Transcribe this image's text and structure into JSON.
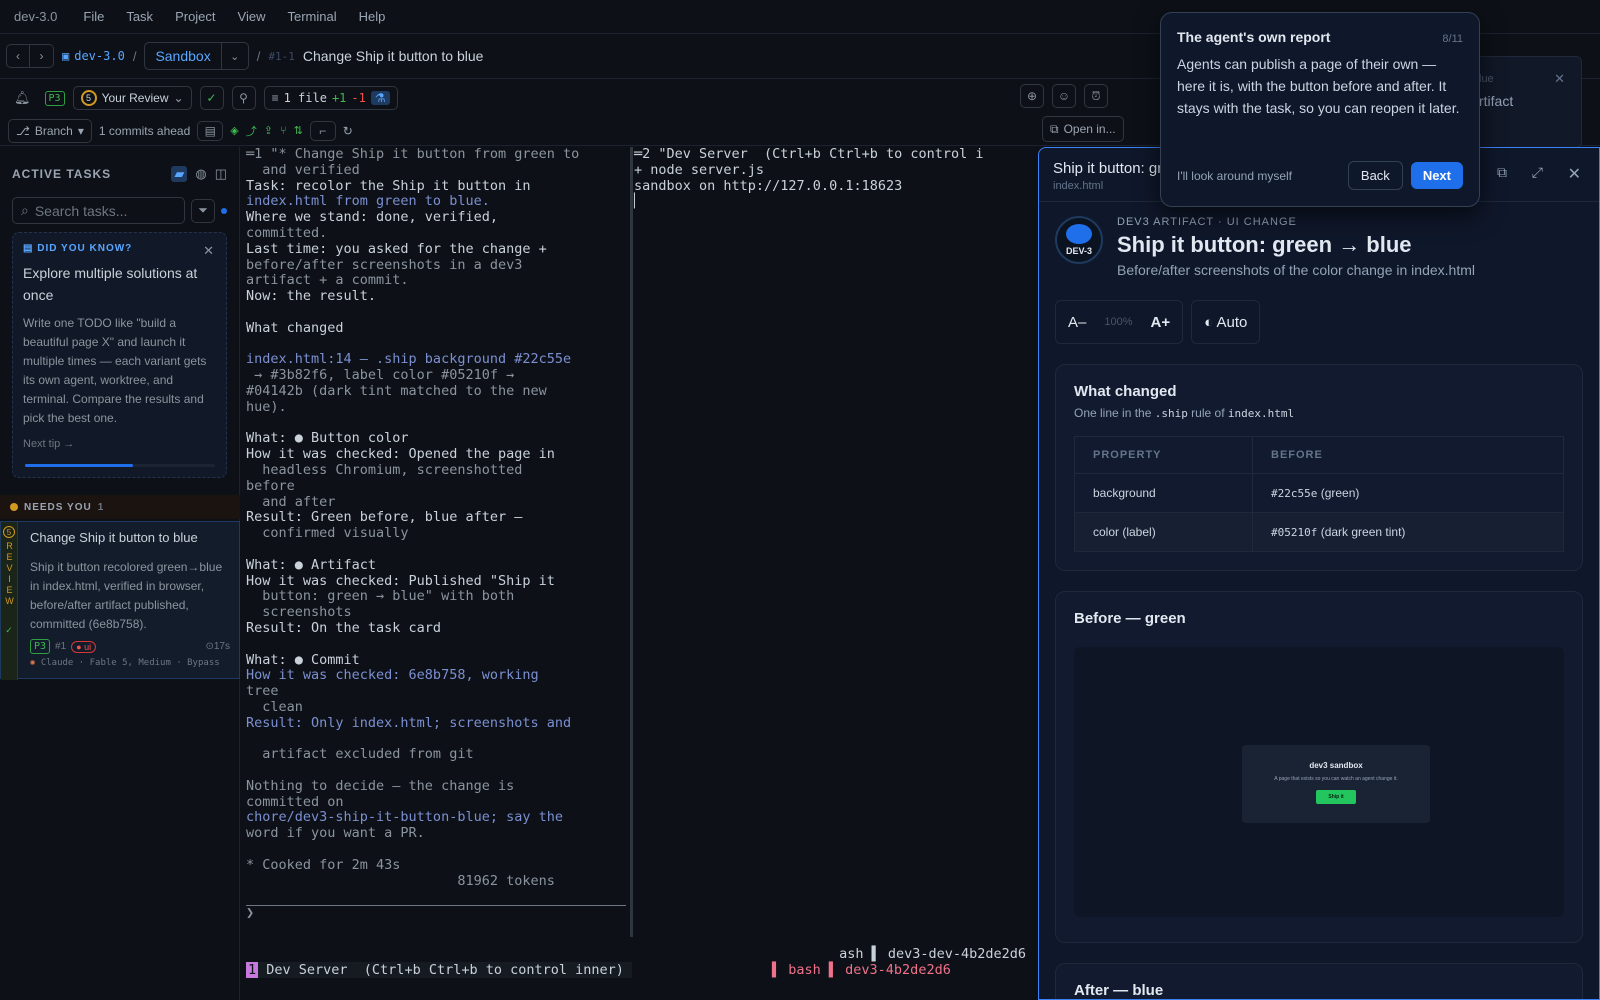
{
  "menubar": {
    "app": "dev-3.0",
    "items": [
      "File",
      "Task",
      "Project",
      "View",
      "Terminal",
      "Help"
    ]
  },
  "crumb": {
    "project": "dev-3.0",
    "sep": "/",
    "branch": "Sandbox",
    "task_id": "#1-1",
    "task_title": "Change Ship it button to blue"
  },
  "toolbar": {
    "priority": "P3",
    "review_count": "5",
    "review_label": "Your Review",
    "files": "1 file",
    "added": "+1",
    "removed": "-1",
    "branch_label": "Branch",
    "ahead": "1 commits ahead",
    "open_in": "Open in..."
  },
  "sidebar": {
    "title": "ACTIVE TASKS",
    "search_placeholder": "Search tasks...",
    "tip": {
      "heading": "DID YOU KNOW?",
      "title": "Explore multiple solutions at once",
      "body": "Write one TODO like \"build a beautiful page X\" and launch it multiple times — each variant gets its own agent, worktree, and terminal. Compare the results and pick the best one.",
      "next": "Next tip →"
    },
    "needs_label": "NEEDS YOU",
    "needs_count": "1",
    "card": {
      "side": "REVIEW",
      "title": "Change Ship it button to blue",
      "desc": "Ship it button recolored green→blue in index.html, verified in browser, before/after artifact published, committed (6e8b758).",
      "p3": "P3",
      "num": "#1",
      "tag": "● ui",
      "time": "⊙17s",
      "agent": "Claude · Fable 5, Medium · Bypass"
    }
  },
  "terminal1": {
    "lines": [
      "═1 \"* Change Ship it button from green to",
      "  and verified",
      "Task: recolor the Ship it button in",
      "index.html from green to blue.",
      "Where we stand: done, verified,",
      "committed.",
      "Last time: you asked for the change +",
      "before/after screenshots in a dev3",
      "artifact + a commit.",
      "Now: the result.",
      "",
      "What changed",
      "",
      "index.html:14 — .ship background #22c55e",
      " → #3b82f6, label color #05210f →",
      "#04142b (dark tint matched to the new",
      "hue).",
      "",
      "What: ● Button color",
      "How it was checked: Opened the page in",
      "  headless Chromium, screenshotted",
      "before",
      "  and after",
      "Result: Green before, blue after —",
      "  confirmed visually",
      "",
      "What: ● Artifact",
      "How it was checked: Published \"Ship it",
      "  button: green → blue\" with both",
      "  screenshots",
      "Result: On the task card",
      "",
      "What: ● Commit",
      "How it was checked: 6e8b758, working",
      "tree",
      "  clean",
      "Result: Only index.html; screenshots and",
      "",
      "  artifact excluded from git",
      "",
      "Nothing to decide — the change is",
      "committed on",
      "chore/dev3-ship-it-button-blue; say the",
      "word if you want a PR.",
      "",
      "* Cooked for 2m 43s",
      "                          81962 tokens",
      "",
      "❯"
    ]
  },
  "terminal2": {
    "lines": [
      "═2 \"Dev Server  (Ctrl+b Ctrl+b to control i",
      "+ node server.js",
      "sandbox on http://127.0.0.1:18623",
      "▏"
    ]
  },
  "statusbar": {
    "line1": "ash ▌ dev3-dev-4b2de2d6",
    "line2_tab": "1",
    "line2_title": " Dev Server  (Ctrl+b Ctrl+b to control inner) ",
    "line2_right": "▌ bash ▌ dev3-4b2de2d6"
  },
  "panel": {
    "title": "Ship it button: gr",
    "subtitle": "index.html",
    "eyebrow": "DEV3 ARTIFACT · UI CHANGE",
    "logo_text": "DEV-3",
    "h1": "Ship it button: green → blue",
    "sub": "Before/after screenshots of the color change in index.html",
    "zoom_minus": "A–",
    "zoom_pct": "100%",
    "zoom_plus": "A+",
    "theme": "◐ Auto",
    "changed": {
      "title": "What changed",
      "sub_pre": "One line in the ",
      "sub_code1": ".ship",
      "sub_mid": " rule of ",
      "sub_code2": "index.html",
      "headers": [
        "PROPERTY",
        "BEFORE"
      ],
      "rows": [
        {
          "prop": "background",
          "code": "#22c55e",
          "note": "(green)"
        },
        {
          "prop": "color (label)",
          "code": "#05210f",
          "note": "(dark green tint)"
        }
      ]
    },
    "before": {
      "title": "Before — green",
      "mini_title": "dev3 sandbox",
      "mini_sub": "A page that exists so you can watch an agent change it.",
      "mini_btn": "Ship it"
    },
    "after": {
      "title": "After — blue"
    }
  },
  "popover": {
    "title": "The agent's own report",
    "step": "8/11",
    "body": "Agents can publish a page of their own — here it is, with the button before and after. It stays with the task, so you can reopen it later.",
    "skip": "I'll look around myself",
    "back": "Back",
    "next": "Next"
  },
  "ghost": {
    "line1": "lue",
    "line2": "rtifact"
  },
  "colors": {
    "accent": "#1f6feb",
    "green": "#22c55e",
    "blue": "#3b82f6"
  }
}
